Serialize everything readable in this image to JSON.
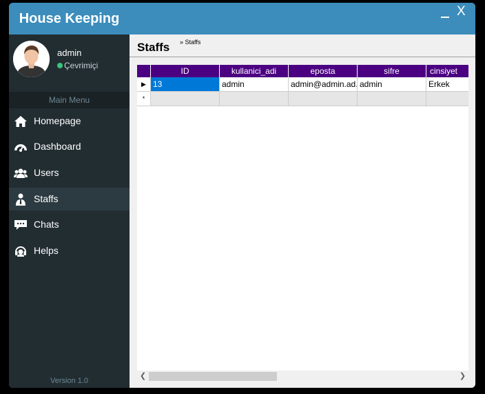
{
  "app": {
    "title": "House Keeping"
  },
  "window_controls": {
    "minimize": "_",
    "close": "X"
  },
  "user": {
    "name": "admin",
    "status": "Çevrimiçi",
    "status_color": "#3ac47d"
  },
  "menu": {
    "header": "Main Menu",
    "items": [
      {
        "label": "Homepage",
        "icon": "home-icon"
      },
      {
        "label": "Dashboard",
        "icon": "dashboard-icon"
      },
      {
        "label": "Users",
        "icon": "users-icon"
      },
      {
        "label": "Staffs",
        "icon": "staff-icon",
        "active": true
      },
      {
        "label": "Chats",
        "icon": "chat-icon"
      },
      {
        "label": "Helps",
        "icon": "headset-icon"
      }
    ]
  },
  "version": "Version 1.0",
  "page": {
    "title": "Staffs",
    "breadcrumb": "» Staffs"
  },
  "grid": {
    "columns": [
      "ID",
      "kullanici_adi",
      "eposta",
      "sifre",
      "cinsiyet"
    ],
    "rows": [
      [
        "13",
        "admin",
        "admin@admin.ad...",
        "admin",
        "Erkek"
      ]
    ],
    "current_row_marker": "▶",
    "new_row_marker": "*"
  },
  "colors": {
    "accent": "#3c8dbc",
    "sidebar": "#222d32",
    "grid_header": "#4b0082",
    "selection": "#0078d7"
  }
}
